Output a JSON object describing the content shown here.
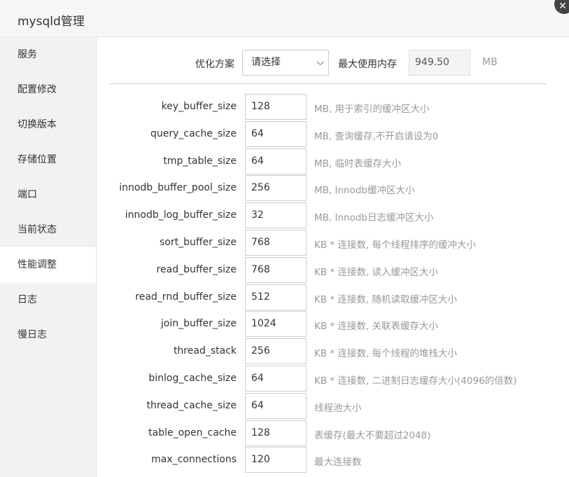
{
  "window": {
    "title": "mysqld管理",
    "close_glyph": "✕"
  },
  "sidebar": {
    "items": [
      {
        "label": "服务",
        "active": false
      },
      {
        "label": "配置修改",
        "active": false
      },
      {
        "label": "切换版本",
        "active": false
      },
      {
        "label": "存储位置",
        "active": false
      },
      {
        "label": "端口",
        "active": false
      },
      {
        "label": "当前状态",
        "active": false
      },
      {
        "label": "性能调整",
        "active": true
      },
      {
        "label": "日志",
        "active": false
      },
      {
        "label": "慢日志",
        "active": false
      }
    ]
  },
  "optimize": {
    "plan_label": "优化方案",
    "plan_selected": "请选择",
    "plan_arrow": "⌵",
    "maxmem_label": "最大使用内存",
    "maxmem_value": "949.50",
    "maxmem_unit": "MB"
  },
  "params": [
    {
      "name": "key_buffer_size",
      "value": "128",
      "desc": "MB, 用于索引的缓冲区大小"
    },
    {
      "name": "query_cache_size",
      "value": "64",
      "desc": "MB, 查询缓存,不开启请设为0"
    },
    {
      "name": "tmp_table_size",
      "value": "64",
      "desc": "MB, 临时表缓存大小"
    },
    {
      "name": "innodb_buffer_pool_size",
      "value": "256",
      "desc": "MB, Innodb缓冲区大小"
    },
    {
      "name": "innodb_log_buffer_size",
      "value": "32",
      "desc": "MB, Innodb日志缓冲区大小"
    },
    {
      "name": "sort_buffer_size",
      "value": "768",
      "desc": "KB * 连接数, 每个线程排序的缓冲大小"
    },
    {
      "name": "read_buffer_size",
      "value": "768",
      "desc": "KB * 连接数, 读入缓冲区大小"
    },
    {
      "name": "read_rnd_buffer_size",
      "value": "512",
      "desc": "KB * 连接数, 随机读取缓冲区大小"
    },
    {
      "name": "join_buffer_size",
      "value": "1024",
      "desc": "KB * 连接数, 关联表缓存大小"
    },
    {
      "name": "thread_stack",
      "value": "256",
      "desc": "KB * 连接数, 每个线程的堆栈大小"
    },
    {
      "name": "binlog_cache_size",
      "value": "64",
      "desc": "KB * 连接数, 二进制日志缓存大小(4096的倍数)"
    },
    {
      "name": "thread_cache_size",
      "value": "64",
      "desc": "线程池大小"
    },
    {
      "name": "table_open_cache",
      "value": "128",
      "desc": "表缓存(最大不要超过2048)"
    },
    {
      "name": "max_connections",
      "value": "120",
      "desc": "最大连接数"
    }
  ]
}
